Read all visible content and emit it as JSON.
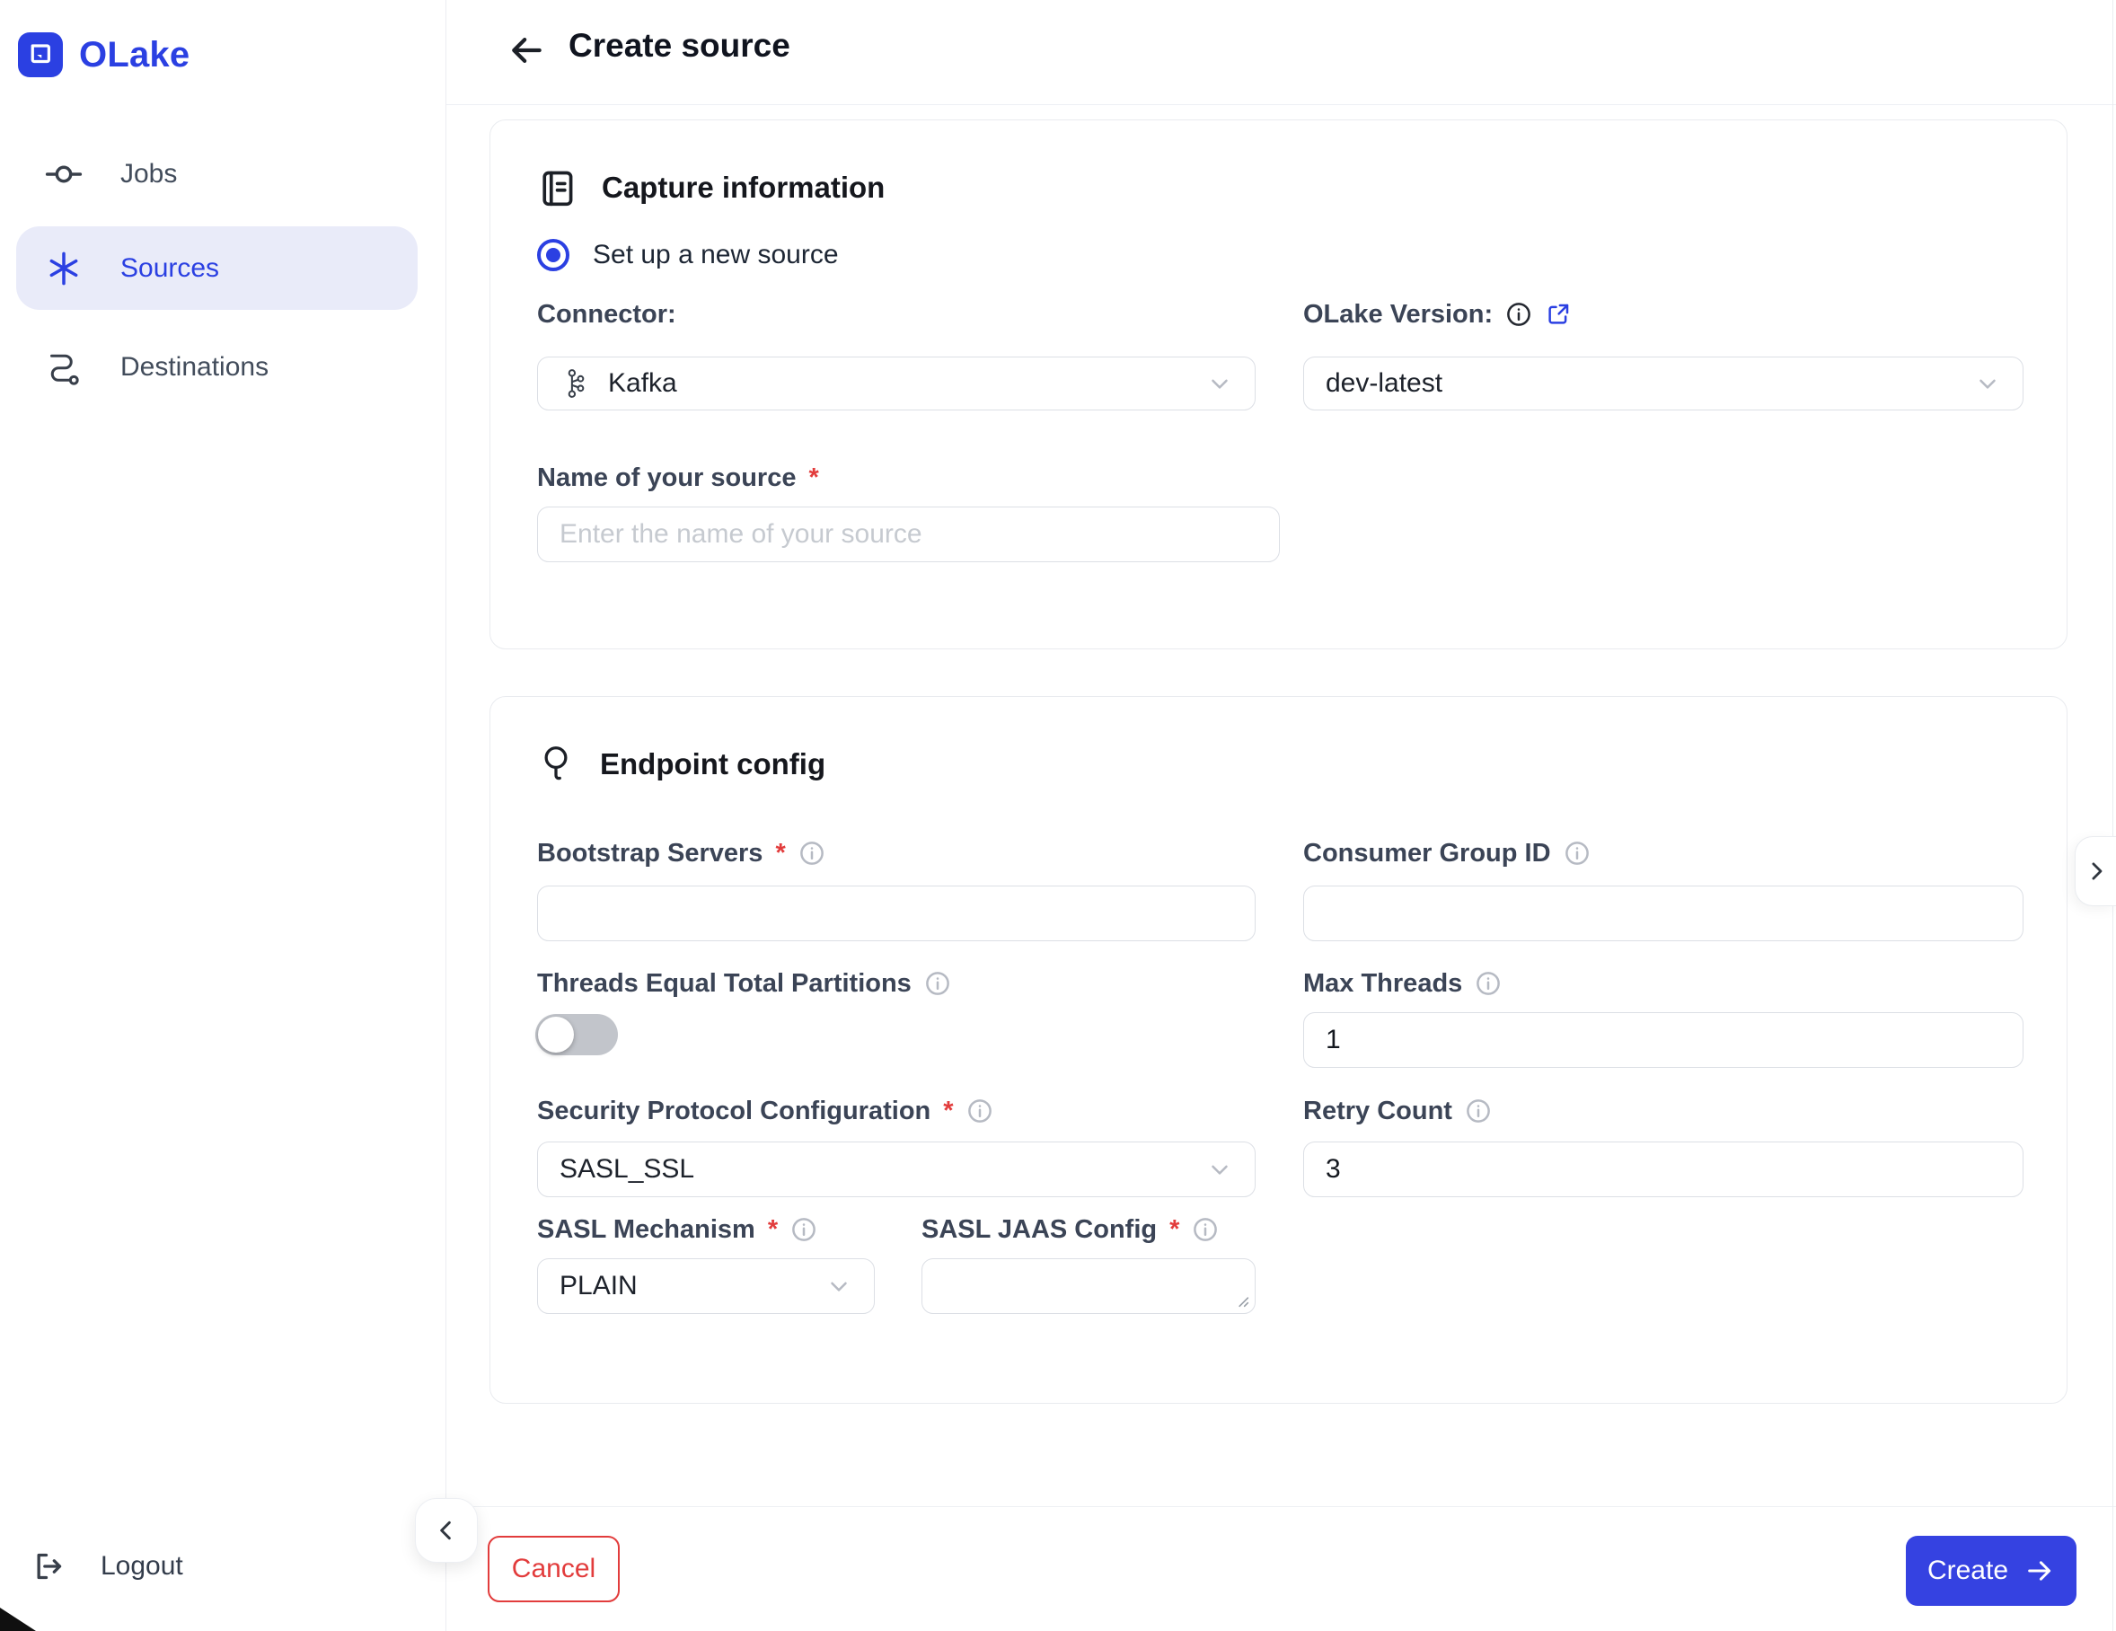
{
  "brand": {
    "name": "OLake"
  },
  "colors": {
    "primary": "#2b40e2",
    "danger": "#e23c3c",
    "active_item_bg": "#e9ebf9",
    "toggle_off": "#c2c5cb"
  },
  "sidebar": {
    "items": [
      {
        "label": "Jobs",
        "active": false
      },
      {
        "label": "Sources",
        "active": true
      },
      {
        "label": "Destinations",
        "active": false
      }
    ],
    "logout_label": "Logout"
  },
  "header": {
    "title": "Create source"
  },
  "capture_card": {
    "title": "Capture information",
    "radio_label": "Set up a new source",
    "connector": {
      "label": "Connector:",
      "value": "Kafka"
    },
    "version": {
      "label": "OLake Version:",
      "value": "dev-latest"
    },
    "name": {
      "label": "Name of your source",
      "placeholder": "Enter the name of your source"
    }
  },
  "endpoint_card": {
    "title": "Endpoint config",
    "bootstrap_servers": {
      "label": "Bootstrap Servers",
      "required": true,
      "value": ""
    },
    "consumer_group_id": {
      "label": "Consumer Group ID",
      "required": false,
      "value": ""
    },
    "threads_equal": {
      "label": "Threads Equal Total Partitions",
      "state": "off"
    },
    "max_threads": {
      "label": "Max Threads",
      "value": "1"
    },
    "security_protocol": {
      "label": "Security Protocol Configuration",
      "required": true,
      "value": "SASL_SSL"
    },
    "retry_count": {
      "label": "Retry Count",
      "value": "3"
    },
    "sasl_mechanism": {
      "label": "SASL Mechanism",
      "required": true,
      "value": "PLAIN"
    },
    "sasl_jaas": {
      "label": "SASL JAAS Config",
      "required": true,
      "value": ""
    }
  },
  "footer": {
    "cancel_label": "Cancel",
    "create_label": "Create"
  },
  "misc": {
    "required_marker": "*"
  },
  "icons": {
    "logo": "olake-logo (blue rounded square, white chat bubble)",
    "nav_jobs": "git-commit-icon",
    "nav_sources": "asterisk-icon",
    "nav_destinations": "route-icon",
    "logout": "logout-icon",
    "back": "arrow-left-icon",
    "capture_section": "journal-icon",
    "endpoint_section": "balloon-pin-icon",
    "connector_value": "kafka-logo-icon",
    "info": "info-circle-icon",
    "external_link": "external-link-icon",
    "select_chevron": "chevron-down-icon",
    "create_arrow": "arrow-right-icon",
    "collapse": "chevron-left-icon",
    "drawer_tab": "chevron-right-icon"
  }
}
